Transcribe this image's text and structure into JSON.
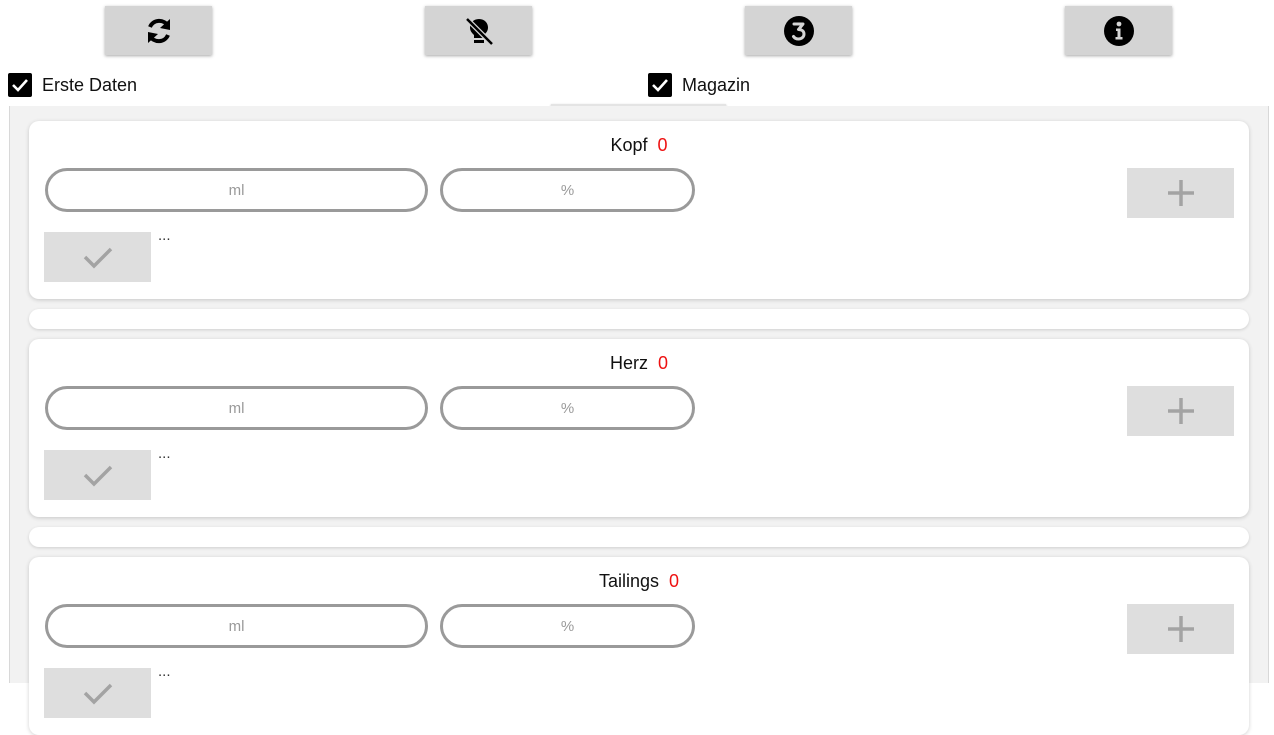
{
  "toolbar": {
    "buttons": [
      {
        "icon": "refresh-icon"
      },
      {
        "icon": "lightbulb-off-icon"
      },
      {
        "icon": "number-three-icon"
      },
      {
        "icon": "info-icon"
      }
    ]
  },
  "filters": {
    "erste_daten": {
      "label": "Erste Daten",
      "checked": true
    },
    "magazin": {
      "label": "Magazin",
      "checked": true
    }
  },
  "sections": [
    {
      "title": "Kopf",
      "count": "0",
      "ml_placeholder": "ml",
      "pct_placeholder": "%",
      "note": "..."
    },
    {
      "title": "Herz",
      "count": "0",
      "ml_placeholder": "ml",
      "pct_placeholder": "%",
      "note": "..."
    },
    {
      "title": "Tailings",
      "count": "0",
      "ml_placeholder": "ml",
      "pct_placeholder": "%",
      "note": "..."
    }
  ],
  "colors": {
    "count": "#ee1111",
    "button_bg": "#d4d4d4",
    "pill_border": "#9a9a9a"
  }
}
